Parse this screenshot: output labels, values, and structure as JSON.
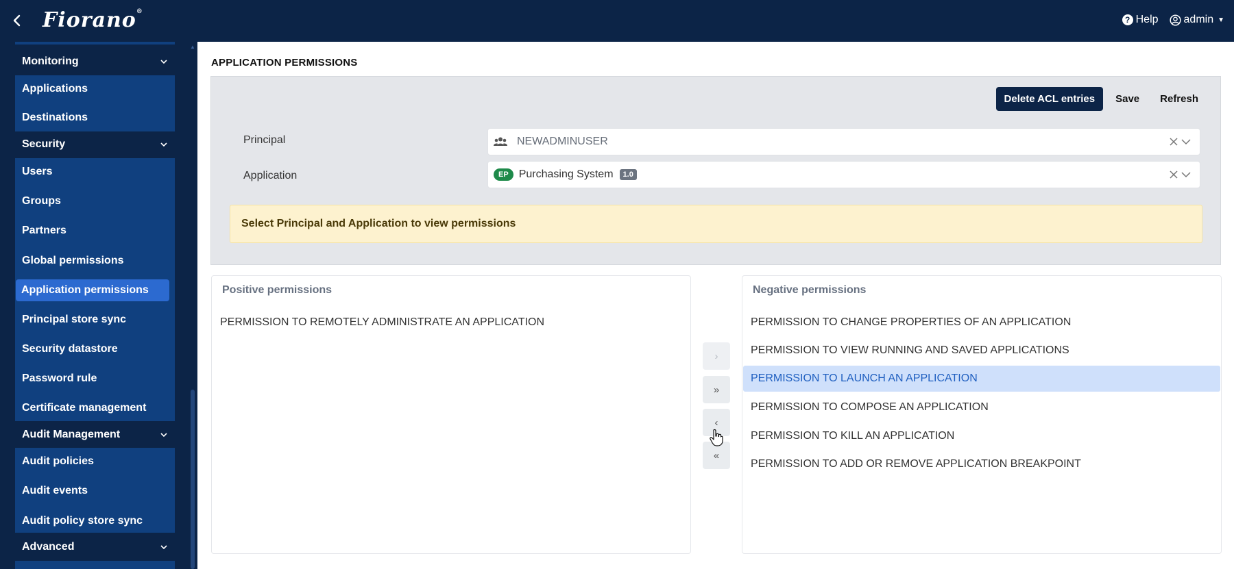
{
  "header": {
    "logo": "Fiorano",
    "logo_mark": "®",
    "help_label": "Help",
    "user_label": "admin"
  },
  "sidebar": {
    "sections": [
      {
        "label": "Monitoring",
        "items": [
          "Applications",
          "Destinations"
        ]
      },
      {
        "label": "Security",
        "items": [
          "Users",
          "Groups",
          "Partners",
          "Global permissions",
          "Application permissions",
          "Principal store sync",
          "Security datastore",
          "Password rule",
          "Certificate management"
        ]
      },
      {
        "label": "Audit Management",
        "items": [
          "Audit policies",
          "Audit events",
          "Audit policy store sync"
        ]
      },
      {
        "label": "Advanced",
        "items": []
      }
    ],
    "active_item": "Application permissions"
  },
  "page": {
    "title": "APPLICATION PERMISSIONS",
    "toolbar": {
      "delete_label": "Delete ACL entries",
      "save_label": "Save",
      "refresh_label": "Refresh"
    },
    "principal": {
      "label": "Principal",
      "value": "NEWADMINUSER"
    },
    "application": {
      "label": "Application",
      "badge": "EP",
      "value": "Purchasing System",
      "version": "1.0"
    },
    "warning": "Select Principal and Application to view permissions",
    "positive": {
      "title": "Positive permissions",
      "items": [
        "PERMISSION TO REMOTELY ADMINISTRATE AN APPLICATION"
      ]
    },
    "negative": {
      "title": "Negative permissions",
      "items": [
        "PERMISSION TO CHANGE PROPERTIES OF AN APPLICATION",
        "PERMISSION TO VIEW RUNNING AND SAVED APPLICATIONS",
        "PERMISSION TO LAUNCH AN APPLICATION",
        "PERMISSION TO COMPOSE AN APPLICATION",
        "PERMISSION TO KILL AN APPLICATION",
        "PERMISSION TO ADD OR REMOVE APPLICATION BREAKPOINT"
      ],
      "selected_item": "PERMISSION TO LAUNCH AN APPLICATION"
    },
    "movers": {
      "move_right": "›",
      "move_all_right": "»",
      "move_left": "‹",
      "move_all_left": "«"
    }
  },
  "colors": {
    "topbar": "#0c2447",
    "sidebar_group": "#10407f",
    "active_item": "#2c6ad0",
    "warning_bg": "#fdf2cf",
    "selected_row": "#cfe0fb"
  }
}
